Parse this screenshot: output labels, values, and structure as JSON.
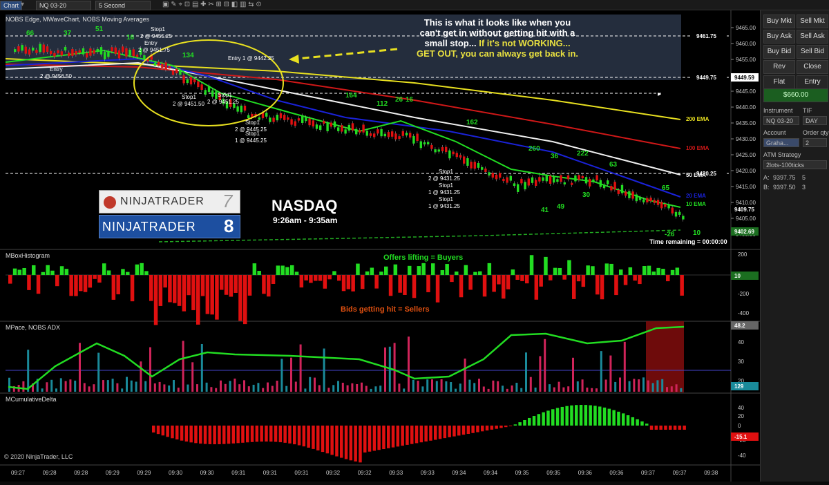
{
  "window": {
    "tab": "Chart"
  },
  "toolbar": {
    "instrument": "NQ 03-20",
    "interval": "5 Second"
  },
  "price_panel": {
    "indicator_title": "NOBS Edge, MWaveChart, NOBS Moving Averages",
    "price_ticks": [
      "9465.00",
      "9460.00",
      "9455.00",
      "9450.00",
      "9445.00",
      "9440.00",
      "9435.00",
      "9430.00",
      "9425.00",
      "9420.00",
      "9415.00",
      "9410.00",
      "9405.00",
      "9400.00"
    ],
    "level_markers": [
      "9461.75",
      "9449.75",
      "9420.25"
    ],
    "current_price": "9409.75",
    "green_price": "9449.59",
    "lower_price": "9402.69",
    "ema_labels": [
      "200 EMA",
      "100 EMA",
      "50 EMA",
      "20 EMA",
      "10 EMA"
    ],
    "time_remaining": "Time remaining = 00:00:00",
    "annotation_lines": [
      "This is what it looks like when you",
      "can't get in without getting hit with a",
      "small stop...",
      "If it's not WORKING...",
      "GET OUT, you can always get back in."
    ],
    "nasdaq_title": "NASDAQ",
    "nasdaq_time": "9:26am - 9:35am",
    "logo_nt7": "NINJATRADER",
    "logo_nt7_num": "7",
    "logo_nt8": "NINJATRADER",
    "logo_nt8_num": "8",
    "trade_labels": [
      {
        "t": "Entry"
      },
      {
        "t": "2 @ 9456.50"
      },
      {
        "t": "Stop1"
      },
      {
        "t": "2 @ 9455.25"
      },
      {
        "t": "Entry"
      },
      {
        "t": "2 @ 9451.75"
      },
      {
        "t": "Entry  1 @ 9442.25"
      },
      {
        "t": "Stop1"
      },
      {
        "t": "2 @ 9451.50"
      },
      {
        "t": "Stop1"
      },
      {
        "t": "2 @ 9451.25"
      },
      {
        "t": "Stop1"
      },
      {
        "t": "2 @ 9445.25"
      },
      {
        "t": "Stop1"
      },
      {
        "t": "1 @ 9445.25"
      },
      {
        "t": "Stop1"
      },
      {
        "t": "2 @ 9431.25"
      },
      {
        "t": "Stop1"
      },
      {
        "t": "1 @ 9431.25"
      },
      {
        "t": "Stop1"
      },
      {
        "t": "1 @ 9431.25"
      }
    ],
    "wave_labels": [
      "66",
      "37",
      "51",
      "16",
      "134",
      "164",
      "112",
      "26",
      "16",
      "162",
      "260",
      "36",
      "222",
      "63",
      "65",
      "30",
      "41",
      "49",
      "10",
      "-26"
    ]
  },
  "mbox": {
    "title": "MBoxHistogram",
    "buyers_label": "Offers lifting = Buyers",
    "sellers_label": "Bids getting hit = Sellers",
    "ticks": [
      "200",
      "0",
      "-200",
      "-400"
    ],
    "value": "10"
  },
  "mpace": {
    "title": "MPace, NOBS ADX",
    "ticks": [
      "40",
      "30",
      "20"
    ],
    "value1": "48.2",
    "value2": "129"
  },
  "mcum": {
    "title": "MCumulativeDelta",
    "ticks": [
      "40",
      "20",
      "0",
      "-20",
      "-40"
    ],
    "value": "-15.1",
    "copyright": "© 2020 NinjaTrader, LLC"
  },
  "time_axis": [
    "09:27",
    "09:28",
    "09:28",
    "09:29",
    "09:29",
    "09:30",
    "09:30",
    "09:31",
    "09:31",
    "09:31",
    "09:32",
    "09:32",
    "09:33",
    "09:33",
    "09:34",
    "09:34",
    "09:35",
    "09:35",
    "09:36",
    "09:36",
    "09:37",
    "09:37",
    "09:38"
  ],
  "order_panel": {
    "buy_mkt": "Buy Mkt",
    "sell_mkt": "Sell Mkt",
    "buy_ask": "Buy Ask",
    "sell_ask": "Sell Ask",
    "buy_bid": "Buy Bid",
    "sell_bid": "Sell Bid",
    "rev": "Rev",
    "close": "Close",
    "flat": "Flat",
    "entry": "Entry",
    "pnl": "$660.00",
    "instrument_label": "Instrument",
    "tif_label": "TIF",
    "instrument_value": "NQ 03-20",
    "tif_value": "DAY",
    "account_label": "Account",
    "qty_label": "Order qty",
    "account_value": "Graha...",
    "qty_value": "2",
    "atm_label": "ATM Strategy",
    "atm_value": "2lots-100ticks",
    "a_label": "A:",
    "a_price": "9397.75",
    "a_size": "5",
    "b_label": "B:",
    "b_price": "9397.50",
    "b_size": "3"
  },
  "colors": {
    "up": "#22dd22",
    "down": "#e01010",
    "ema200": "#e8e020",
    "ema100": "#d01818",
    "ema50": "#f0f0f0",
    "ema20": "#1a22d8",
    "ema10": "#22dd22",
    "accent": "#e8e040"
  }
}
